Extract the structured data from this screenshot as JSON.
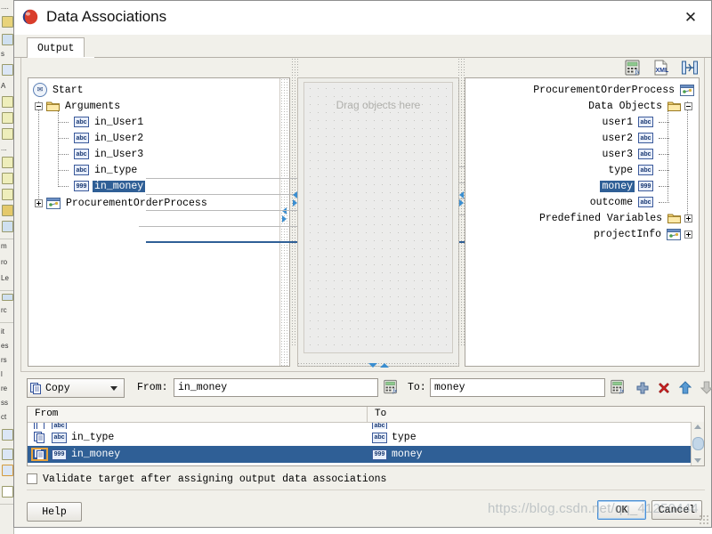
{
  "window": {
    "title": "Data Associations",
    "app_icon": "eclipse-icon",
    "close_label": "✕"
  },
  "tabs": [
    {
      "label": "Output",
      "active": true
    }
  ],
  "toolbar": {
    "icons": [
      {
        "name": "expression-editor-icon",
        "title": "fx"
      },
      {
        "name": "xml-document-icon",
        "title": "XML"
      },
      {
        "name": "auto-map-icon",
        "title": "Map"
      }
    ]
  },
  "left_tree": {
    "root": {
      "label": "Start",
      "icon": "message-start-icon"
    },
    "groups": [
      {
        "label": "Arguments",
        "icon": "folder-icon",
        "expanded": true,
        "items": [
          {
            "label": "in_User1",
            "icon": "abc-icon",
            "type": "abc",
            "selected": false
          },
          {
            "label": "in_User2",
            "icon": "abc-icon",
            "type": "abc",
            "selected": false
          },
          {
            "label": "in_User3",
            "icon": "abc-icon",
            "type": "abc",
            "selected": false
          },
          {
            "label": "in_type",
            "icon": "abc-icon",
            "type": "abc",
            "selected": false
          },
          {
            "label": "in_money",
            "icon": "999-icon",
            "type": "999",
            "selected": true
          }
        ]
      },
      {
        "label": "ProcurementOrderProcess",
        "icon": "process-icon",
        "expanded": false,
        "items": []
      }
    ]
  },
  "center": {
    "drop_hint": "Drag objects here"
  },
  "right_tree": {
    "root": {
      "label": "ProcurementOrderProcess",
      "icon": "process-icon"
    },
    "groups": [
      {
        "label": "Data Objects",
        "icon": "folder-icon",
        "expanded": true,
        "items": [
          {
            "label": "user1",
            "icon": "abc-icon",
            "type": "abc",
            "selected": false
          },
          {
            "label": "user2",
            "icon": "abc-icon",
            "type": "abc",
            "selected": false
          },
          {
            "label": "user3",
            "icon": "abc-icon",
            "type": "abc",
            "selected": false
          },
          {
            "label": "type",
            "icon": "abc-icon",
            "type": "abc",
            "selected": false
          },
          {
            "label": "money",
            "icon": "999-icon",
            "type": "999",
            "selected": true
          },
          {
            "label": "outcome",
            "icon": "abc-icon",
            "type": "abc",
            "selected": false
          }
        ]
      },
      {
        "label": "Predefined Variables",
        "icon": "folder-icon",
        "expanded": false,
        "items": []
      },
      {
        "label": "projectInfo",
        "icon": "process-icon",
        "expanded": false,
        "items": []
      }
    ]
  },
  "editor": {
    "operation": {
      "label": "Copy",
      "icon": "copy-icon"
    },
    "from": {
      "label": "From:",
      "value": "in_money",
      "placeholder": ""
    },
    "to": {
      "label": "To:",
      "value": "money",
      "placeholder": ""
    },
    "from_expression_icon": "expression-editor-icon",
    "to_expression_icon": "expression-editor-icon",
    "actions": [
      {
        "name": "add-mapping-button",
        "icon": "plus-icon"
      },
      {
        "name": "delete-mapping-button",
        "icon": "delete-x-icon"
      },
      {
        "name": "move-up-button",
        "icon": "arrow-up-icon"
      },
      {
        "name": "move-down-button",
        "icon": "arrow-down-icon"
      }
    ]
  },
  "table": {
    "columns": [
      "From",
      "To"
    ],
    "rows": [
      {
        "from": {
          "label": "",
          "type": "abc"
        },
        "to": {
          "label": "",
          "type": "abc"
        },
        "partial": true,
        "selected": false
      },
      {
        "from": {
          "label": "in_type",
          "type": "abc"
        },
        "to": {
          "label": "type",
          "type": "abc"
        },
        "partial": false,
        "selected": false
      },
      {
        "from": {
          "label": "in_money",
          "type": "999"
        },
        "to": {
          "label": "money",
          "type": "999"
        },
        "partial": false,
        "selected": true
      }
    ],
    "row_icon": "copy-icon",
    "scrollbar": {
      "up": "▲",
      "down": "▼"
    }
  },
  "options": {
    "validate_checkbox": {
      "label": "Validate target after assigning output data associations",
      "checked": false
    }
  },
  "buttons": {
    "help": "Help",
    "ok": "OK",
    "cancel": "Cancel"
  },
  "watermark": "https://blog.csdn.net/qq_41250444",
  "colors": {
    "selection": "#2f5f96",
    "dialog_bg": "#f1f0ea",
    "accent_arrow": "#3b8ed0",
    "focus_border": "#4b8fd4",
    "delete_red": "#cc2222"
  }
}
